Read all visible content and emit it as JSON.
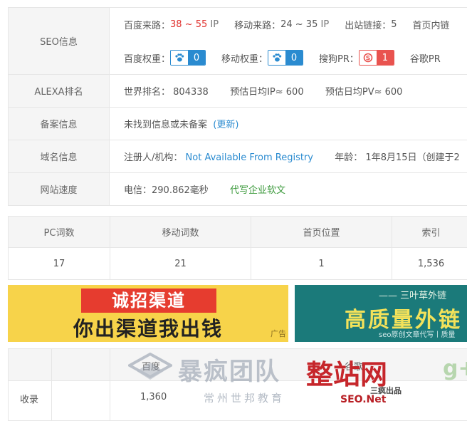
{
  "seo": {
    "label": "SEO信息",
    "baidu_route_label": "百度来路：",
    "baidu_route_value": "38 ~ 55",
    "ip1": "IP",
    "mobile_route_label": "移动来路：",
    "mobile_route_value": "24 ~ 35",
    "ip2": "IP",
    "outlinks_label": "出站链接：",
    "outlinks_value": "5",
    "homepage_label": "首页内链",
    "baidu_weight_label": "百度权重：",
    "baidu_weight_value": "0",
    "mobile_weight_label": "移动权重：",
    "mobile_weight_value": "0",
    "sogou_label": "搜狗PR：",
    "sogou_value": "1",
    "google_label": "谷歌PR"
  },
  "alexa": {
    "label": "ALEXA排名",
    "world_label": "世界排名：",
    "world_value": "804338",
    "ip_est": "预估日均IP≈ 600",
    "pv_est": "预估日均PV≈ 600"
  },
  "beian": {
    "label": "备案信息",
    "value": "未找到信息或未备案",
    "update_link": "(更新)"
  },
  "domain": {
    "label": "域名信息",
    "registrant_label": "注册人/机构：",
    "registrant_value": "Not Available From Registry",
    "age_label": "年龄：",
    "age_value": "1年8月15日（创建于2"
  },
  "speed": {
    "label": "网站速度",
    "telecom": "电信：290.862毫秒",
    "ad_link": "代写企业软文"
  },
  "words": {
    "headers": [
      "PC词数",
      "移动词数",
      "首页位置",
      "索引"
    ],
    "values": [
      "17",
      "21",
      "1",
      "1,536"
    ]
  },
  "banner_left": {
    "top": "诚招渠道",
    "bottom": "你出渠道我出钱",
    "ad": "广告"
  },
  "banner_right": {
    "line1": "—— 三叶草外链",
    "line2": "高质量外链",
    "line3": "seo原创文章代写丨质量"
  },
  "bottom_table": {
    "col1": "百度",
    "col2": "谷歌",
    "row_label": "收录",
    "row_value": "1,360"
  },
  "watermark": {
    "logo_text": "暴疯团队",
    "sub_text": "常州世邦教育",
    "site_text": "整站网",
    "site_sub": "SEO.Net",
    "site_mid": "三疯出品"
  },
  "colors": {
    "red": "#e0312e",
    "blue": "#2a8bd0",
    "green": "#3c9a3c",
    "banner_yellow": "#f7d34a",
    "banner_teal": "#1b7a7a"
  }
}
